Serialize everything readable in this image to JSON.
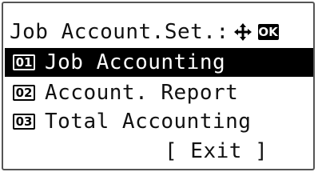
{
  "screen": {
    "title": "Job Account.Set.:",
    "ok_label": "OK",
    "nav_icon": "four-way-arrow-icon"
  },
  "menu": {
    "items": [
      {
        "number": "01",
        "label": "Job Accounting",
        "selected": true
      },
      {
        "number": "02",
        "label": "Account. Report",
        "selected": false
      },
      {
        "number": "03",
        "label": "Total Accounting",
        "selected": false
      }
    ]
  },
  "exit": {
    "label": "[ Exit ]"
  },
  "colors": {
    "background": "#ffffff",
    "selection": "#000000",
    "text": "#111111"
  }
}
